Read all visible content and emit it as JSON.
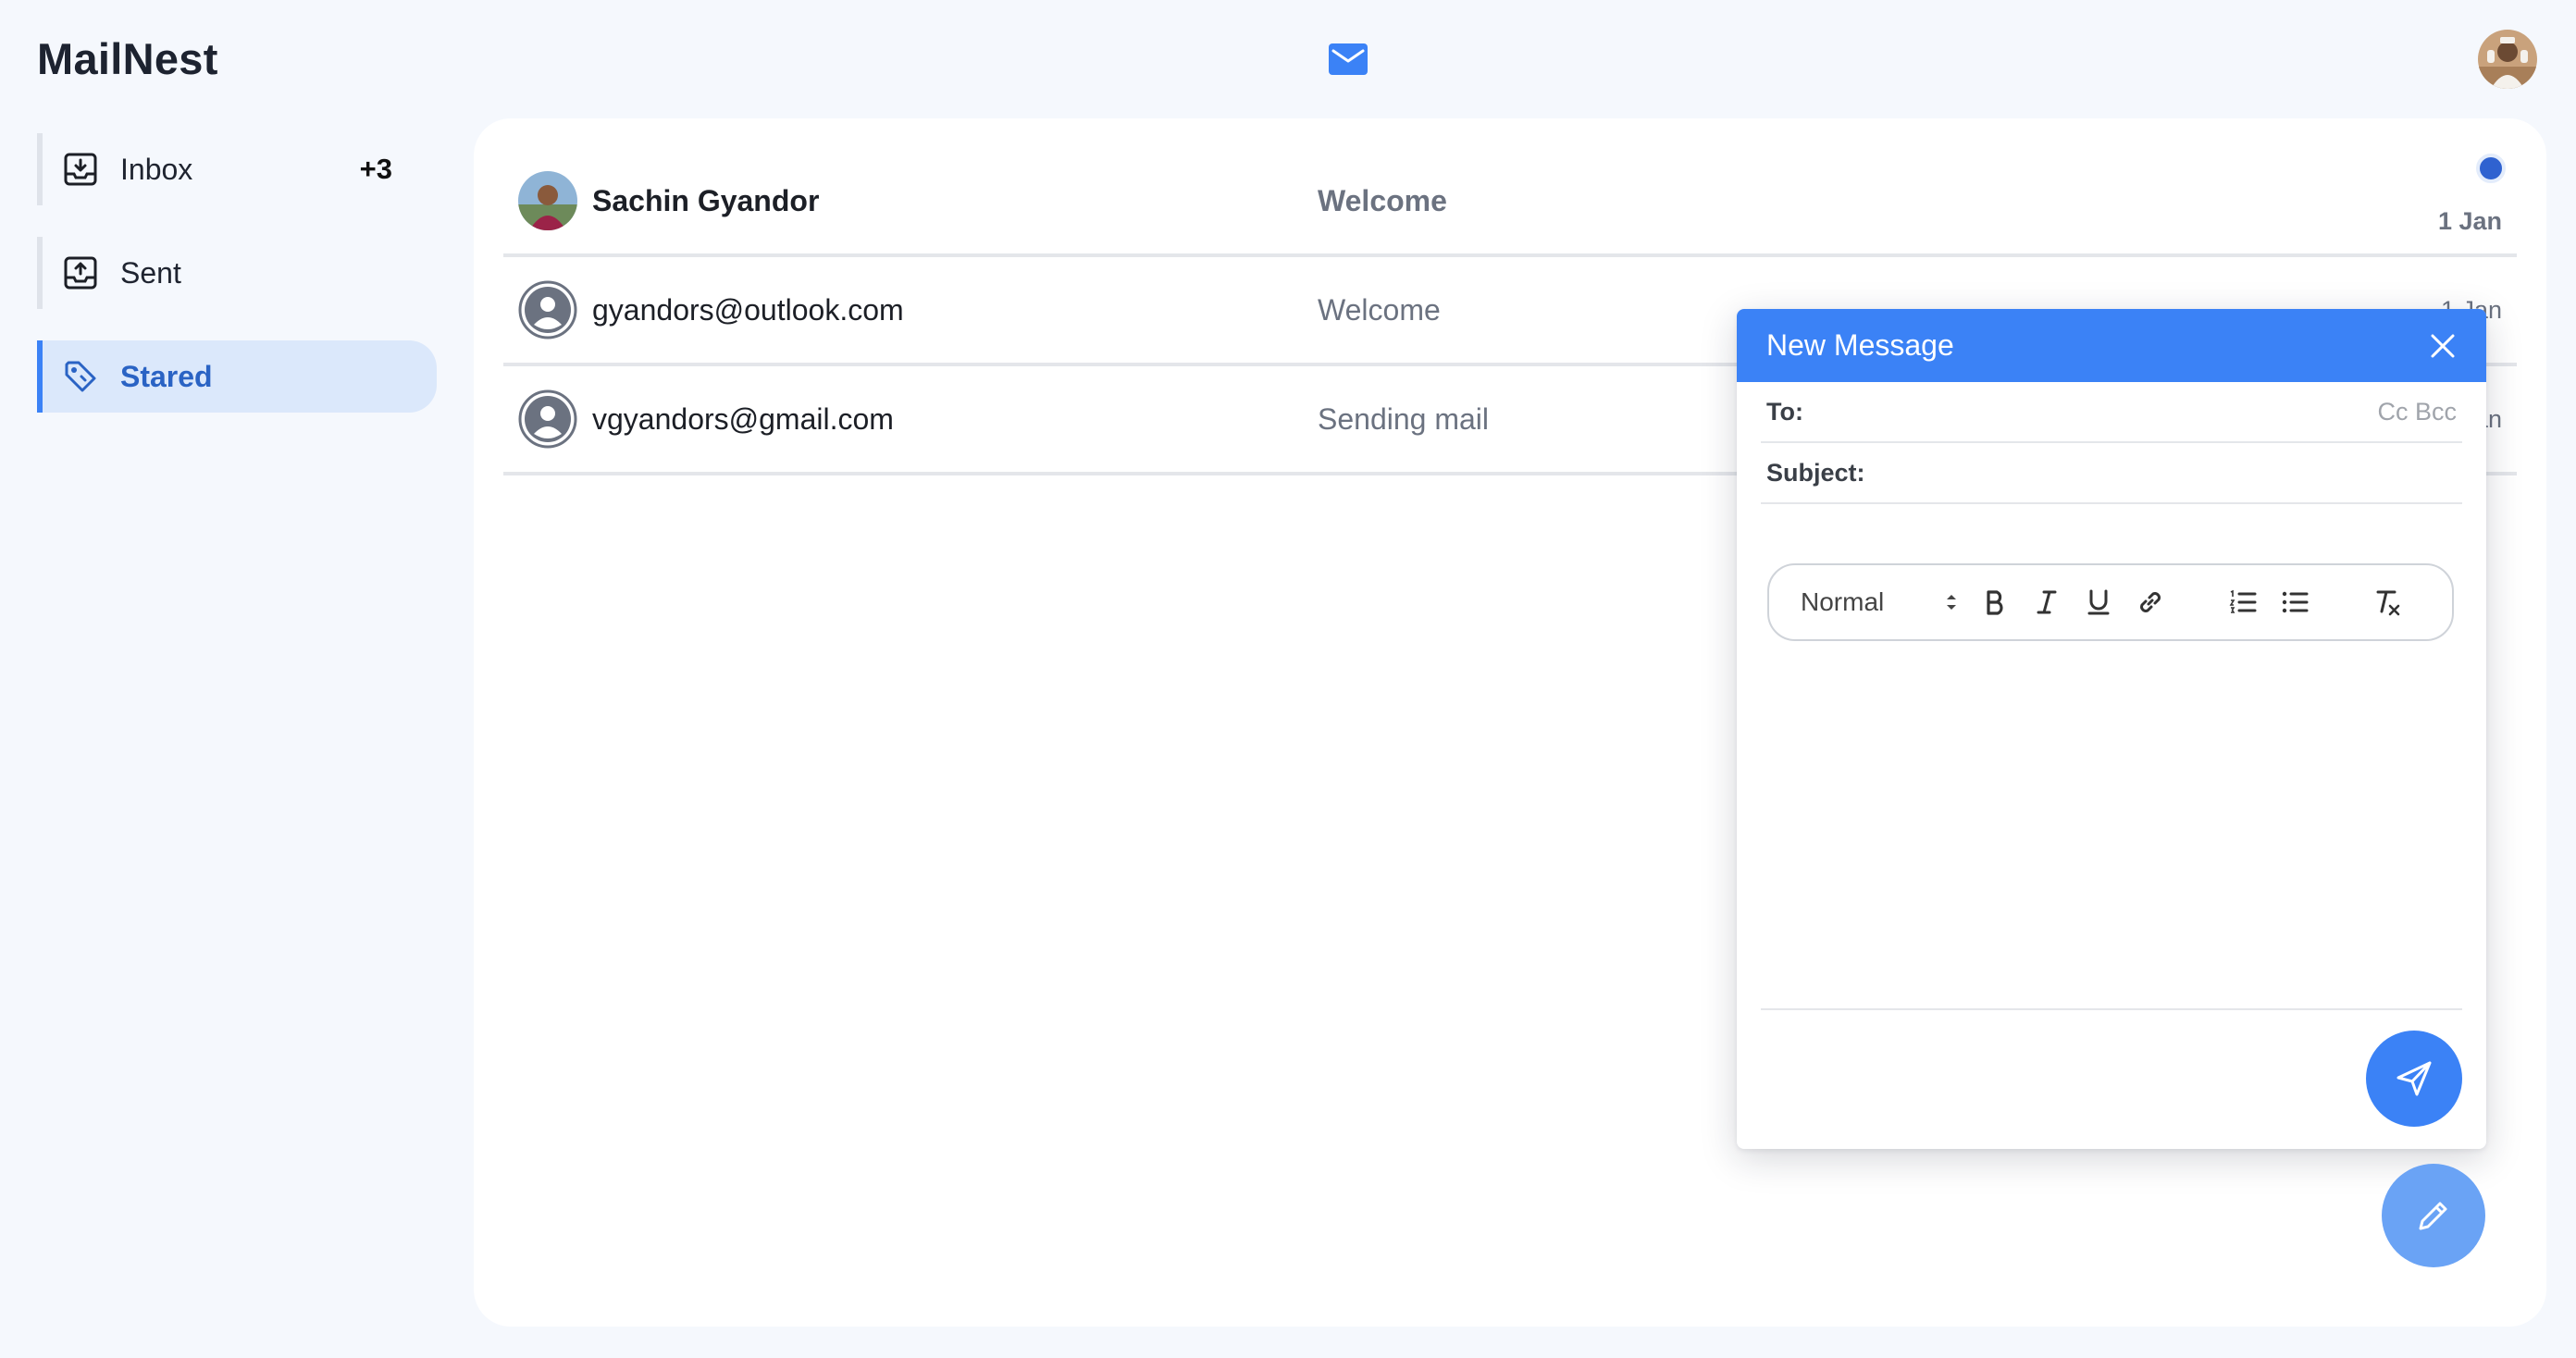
{
  "app": {
    "title": "MailNest"
  },
  "header": {
    "mail_icon": "envelope-icon",
    "avatar_icon": "user-avatar"
  },
  "sidebar": {
    "items": [
      {
        "label": "Inbox",
        "badge": "+3",
        "icon": "inbox-download-icon",
        "active": false
      },
      {
        "label": "Sent",
        "badge": "",
        "icon": "outbox-upload-icon",
        "active": false
      },
      {
        "label": "Stared",
        "badge": "",
        "icon": "tag-icon",
        "active": true
      }
    ]
  },
  "mails": [
    {
      "sender": "Sachin Gyandor",
      "subject": "Welcome",
      "date": "1 Jan",
      "unread": true,
      "avatar": "photo"
    },
    {
      "sender": "gyandors@outlook.com",
      "subject": "Welcome",
      "date": "1 Jan",
      "unread": false,
      "avatar": "default-user"
    },
    {
      "sender": "vgyandors@gmail.com",
      "subject": "Sending mail",
      "date": "1 Jan",
      "unread": false,
      "avatar": "default-user"
    }
  ],
  "compose": {
    "title": "New Message",
    "to_label": "To:",
    "to_value": "",
    "cc_bcc": "Cc Bcc",
    "subject_label": "Subject:",
    "subject_value": "",
    "format_select": "Normal",
    "toolbar_icons": [
      "bold-icon",
      "italic-icon",
      "underline-icon",
      "link-icon",
      "ordered-list-icon",
      "bullet-list-icon",
      "clear-format-icon"
    ]
  },
  "colors": {
    "accent": "#3b82f6",
    "background": "#f5f8fd",
    "active_nav_bg": "#dbe8fb",
    "unread_dot": "#2f62d0"
  }
}
